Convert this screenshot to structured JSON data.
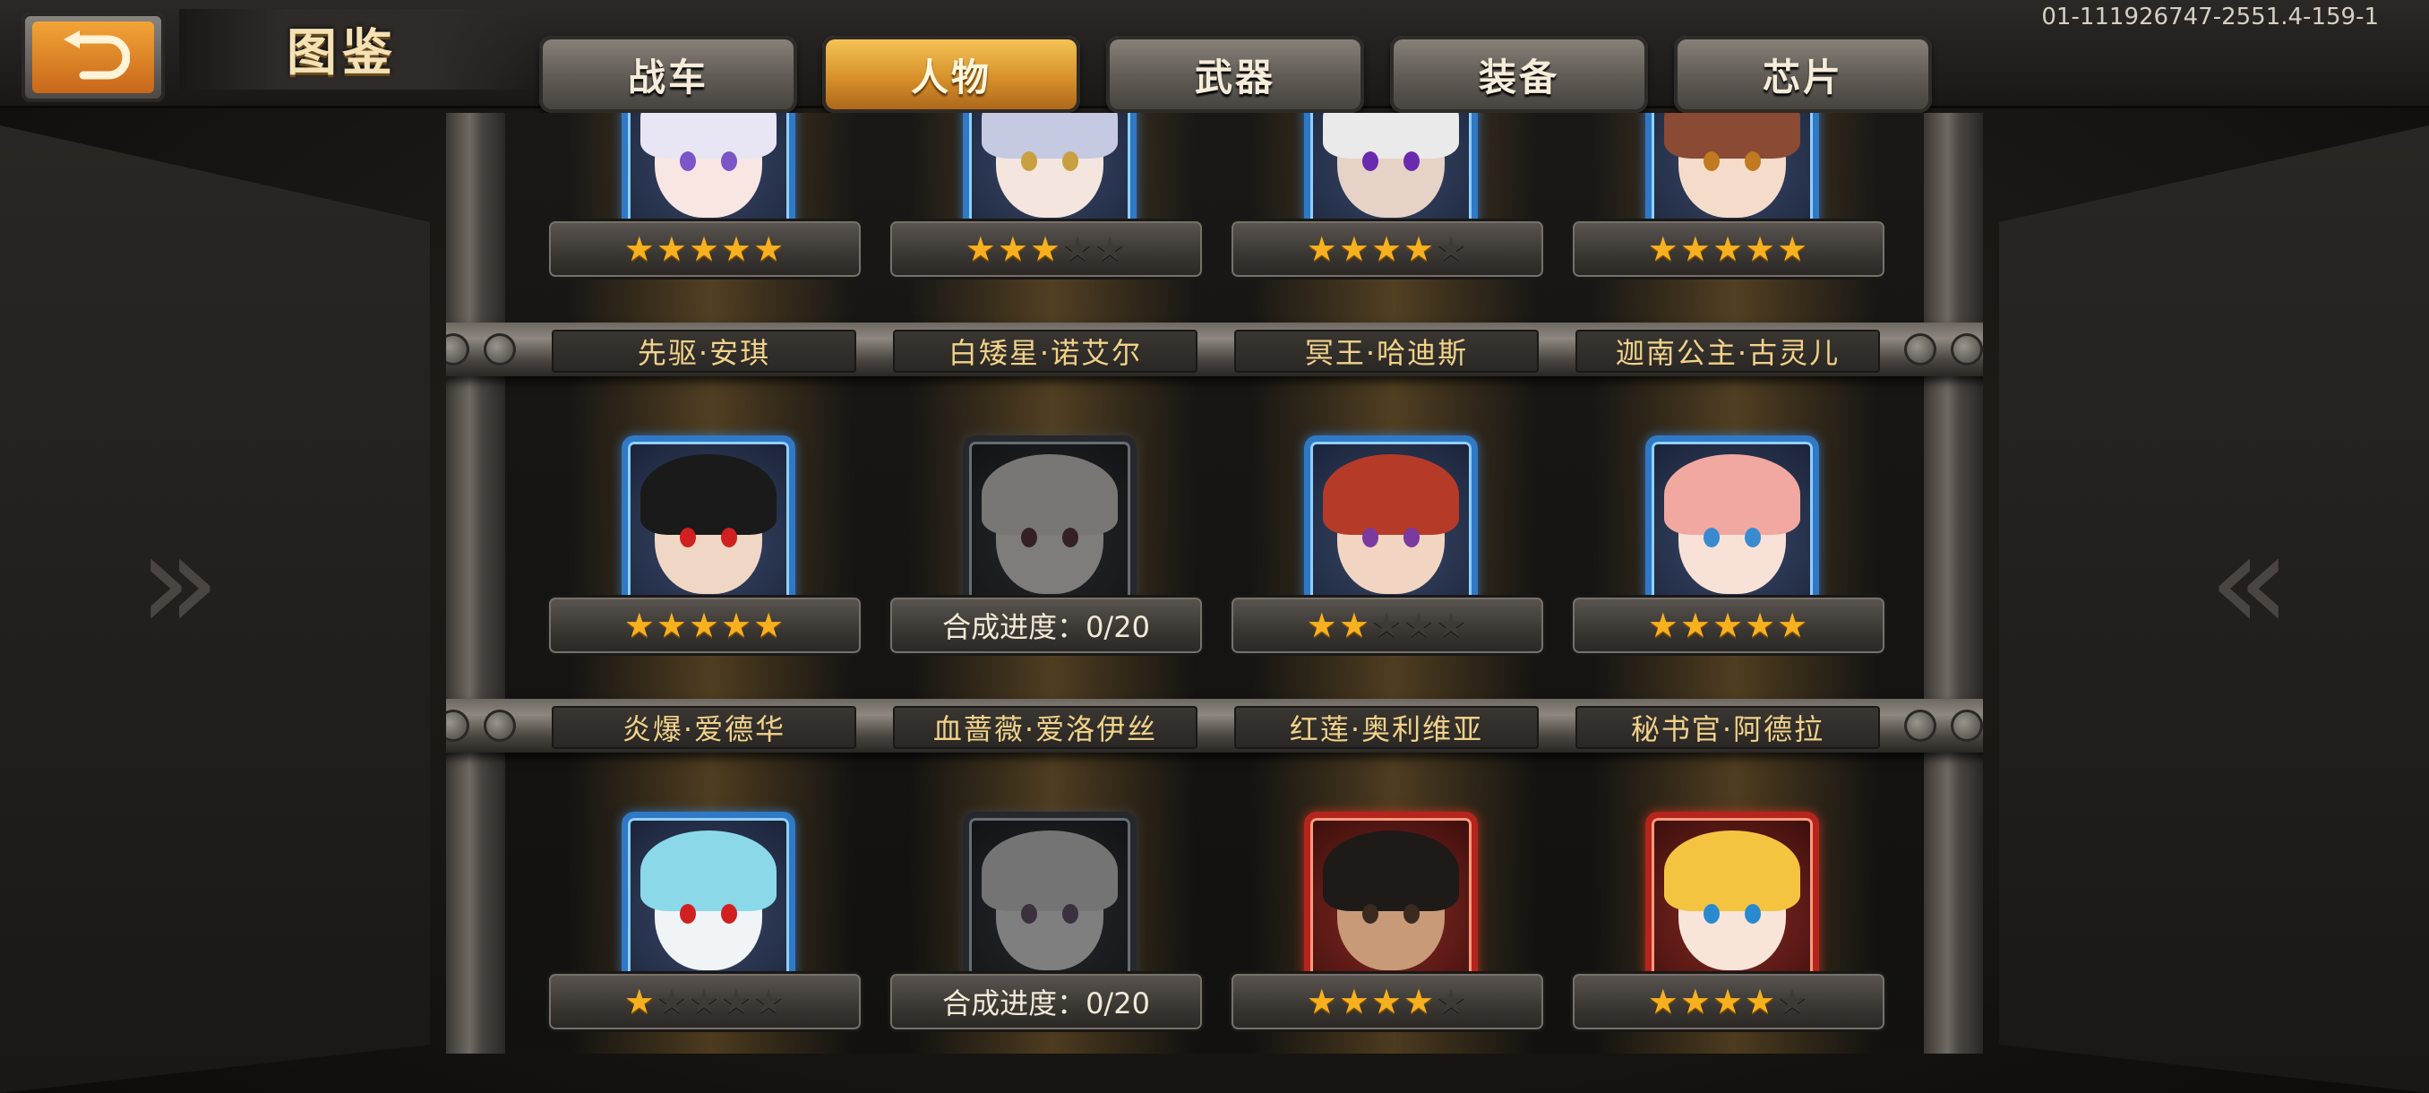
{
  "header": {
    "title": "图鉴",
    "version": "01-111926747-2551.4-159-1"
  },
  "tabs": [
    {
      "label": "战车",
      "active": false
    },
    {
      "label": "人物",
      "active": true
    },
    {
      "label": "武器",
      "active": false
    },
    {
      "label": "装备",
      "active": false
    },
    {
      "label": "芯片",
      "active": false
    }
  ],
  "rows": [
    [
      {
        "name": "先驱·安琪",
        "stars": 5,
        "hair": "#e8e6f4",
        "skin": "#f7e6e2",
        "eye": "#7a56c8"
      },
      {
        "name": "白矮星·诺艾尔",
        "stars": 3,
        "hair": "#c5c9e2",
        "skin": "#f4e6de",
        "eye": "#c8a040"
      },
      {
        "name": "冥王·哈迪斯",
        "stars": 4,
        "hair": "#eaeaea",
        "skin": "#e6d2c6",
        "eye": "#6a2ab0"
      },
      {
        "name": "迦南公主·古灵儿",
        "stars": 5,
        "hair": "#8a4a34",
        "skin": "#f5dcca",
        "eye": "#c27a20"
      }
    ],
    [
      {
        "name": "炎爆·爱德华",
        "stars": 5,
        "hair": "#1a1a1a",
        "skin": "#f0d6c4",
        "eye": "#d02020"
      },
      {
        "name": "血蔷薇·爱洛伊丝",
        "progress": "合成进度：0/20",
        "locked": true,
        "hair": "#e0d8d0",
        "skin": "#f0e0da",
        "eye": "#c02030"
      },
      {
        "name": "红莲·奥利维亚",
        "stars": 2,
        "hair": "#b53a28",
        "skin": "#f2d4c2",
        "eye": "#7a3aa0"
      },
      {
        "name": "秘书官·阿德拉",
        "stars": 5,
        "hair": "#f0a8a0",
        "skin": "#f8e2d8",
        "eye": "#3a8ad0"
      }
    ],
    [
      {
        "name": "",
        "stars": 1,
        "hair": "#8ad8e8",
        "skin": "#f0f4f6",
        "eye": "#d02020"
      },
      {
        "name": "",
        "progress": "合成进度：0/20",
        "locked": true,
        "hair": "#d8d2d8",
        "skin": "#ece6ea",
        "eye": "#9a40c0"
      },
      {
        "name": "",
        "stars": 4,
        "hair": "#1e1a18",
        "skin": "#c89a78",
        "eye": "#3a2a20",
        "frame": "red"
      },
      {
        "name": "",
        "stars": 4,
        "hair": "#f4c440",
        "skin": "#f8e4d8",
        "eye": "#2a8ad0",
        "frame": "red"
      }
    ]
  ],
  "icons": {
    "back": "return-arrow-icon",
    "star": "star-icon"
  },
  "colors": {
    "accent_gold": "#f0d28a",
    "star_on": "#f7b01e",
    "tab_active": "#d7902a",
    "frame_blue": "#2f79c6",
    "frame_red": "#b5241d"
  }
}
